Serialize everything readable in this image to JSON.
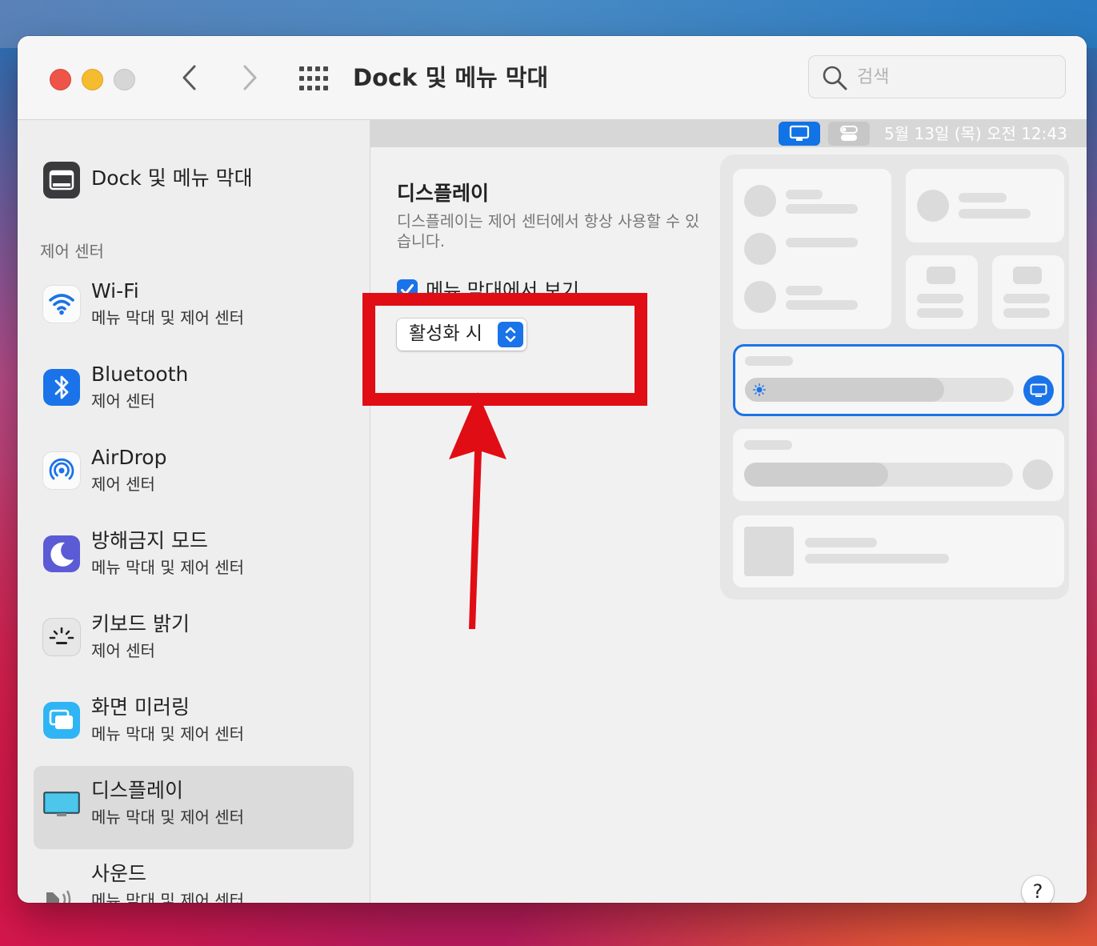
{
  "window": {
    "title": "Dock 및 메뉴 막대",
    "search_placeholder": "검색"
  },
  "sidebar": {
    "top_item": {
      "label": "Dock 및 메뉴 막대",
      "icon": "dock-icon"
    },
    "section_label": "제어 센터",
    "items": [
      {
        "name": "Wi-Fi",
        "subtitle": "메뉴 막대 및 제어 센터",
        "icon": "wifi-icon",
        "selected": false
      },
      {
        "name": "Bluetooth",
        "subtitle": "제어 센터",
        "icon": "bluetooth-icon",
        "selected": false
      },
      {
        "name": "AirDrop",
        "subtitle": "제어 센터",
        "icon": "airdrop-icon",
        "selected": false
      },
      {
        "name": "방해금지 모드",
        "subtitle": "메뉴 막대 및 제어 센터",
        "icon": "moon-icon",
        "selected": false
      },
      {
        "name": "키보드 밝기",
        "subtitle": "제어 센터",
        "icon": "keyboard-brightness-icon",
        "selected": false
      },
      {
        "name": "화면 미러링",
        "subtitle": "메뉴 막대 및 제어 센터",
        "icon": "screen-mirroring-icon",
        "selected": false
      },
      {
        "name": "디스플레이",
        "subtitle": "메뉴 막대 및 제어 센터",
        "icon": "display-icon",
        "selected": true
      },
      {
        "name": "사운드",
        "subtitle": "메뉴 막대 및 제어 센터",
        "icon": "speaker-icon",
        "selected": false
      }
    ]
  },
  "menubar_preview": {
    "clock": "5월 13일 (목) 오전  12:43"
  },
  "detail": {
    "title": "디스플레이",
    "description": "디스플레이는 제어 센터에서 항상 사용할 수 있습니다.",
    "checkbox_label": "메뉴 막대에서 보기",
    "checkbox_checked": true,
    "popup_value": "활성화 시"
  },
  "preview": {
    "brightness_level": 0.74
  },
  "help_label": "?",
  "colors": {
    "accent": "#1a73e8",
    "annotation": "#e00d14",
    "selected_row": "#dcdbdc"
  }
}
